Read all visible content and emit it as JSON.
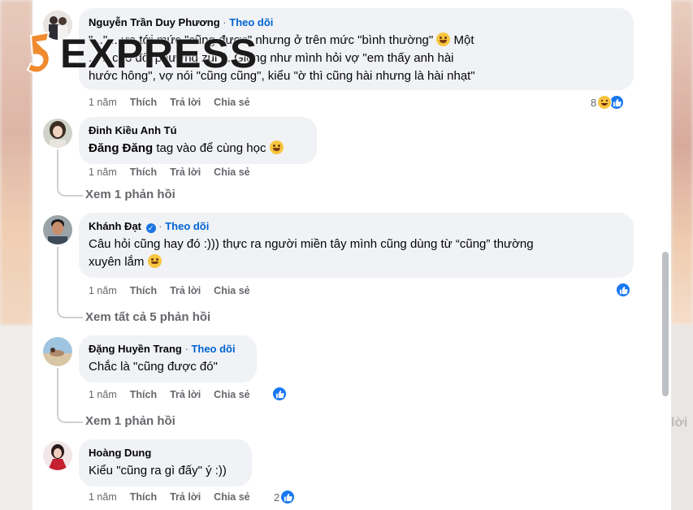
{
  "background": {
    "right_label": "lời"
  },
  "watermark": {
    "text": "EXPRESS"
  },
  "comments": [
    {
      "author": "Nguyễn Trần Duy Phương",
      "follow": "Theo dõi",
      "text_line1": "\"...\" ...ưa tới mức \"cũng được\" nhưng ở trên mức \"bình thường\"",
      "text_line1_tail": "Một",
      "text_line2": "... ...cho đối phương zui á. Giống như mình hỏi vợ \"em thấy anh hài",
      "text_line3": "hước hông\", vợ nói \"cũng cũng\", kiểu \"ờ thì cũng hài nhưng là hài nhạt\"",
      "time": "1 năm",
      "like": "Thích",
      "reply": "Trả lời",
      "share": "Chia sẻ",
      "reaction_count": "8"
    },
    {
      "author": "Đinh Kiều Anh Tú",
      "mention": "Đăng Đăng",
      "text": "tag vào để cùng học",
      "time": "1 năm",
      "like": "Thích",
      "reply": "Trả lời",
      "share": "Chia sẻ",
      "view_replies": "Xem 1 phản hồi"
    },
    {
      "author": "Khánh Đạt",
      "follow": "Theo dõi",
      "text_line1": "Câu hỏi cũng hay đó :))) thực ra người miền tây mình cũng dùng từ “cũng” thường",
      "text_line2": "xuyên lắm",
      "time": "1 năm",
      "like": "Thích",
      "reply": "Trả lời",
      "share": "Chia sẻ",
      "view_replies": "Xem tất cả 5 phản hồi"
    },
    {
      "author": "Đặng Huyền Trang",
      "follow": "Theo dõi",
      "text": "Chắc là \"cũng được đó\"",
      "time": "1 năm",
      "like": "Thích",
      "reply": "Trả lời",
      "share": "Chia sẻ",
      "view_replies": "Xem 1 phản hồi"
    },
    {
      "author": "Hoàng Dung",
      "text": "Kiểu \"cũng ra gì đấy\" ý :))",
      "time": "1 năm",
      "like": "Thích",
      "reply": "Trả lời",
      "share": "Chia sẻ",
      "reaction_count": "2"
    }
  ],
  "colors": {
    "link_blue": "#0064d1",
    "like_blue": "#1877f2",
    "bubble": "#f0f2f5",
    "meta_gray": "#65676b"
  },
  "icons": [
    "like-icon",
    "haha-icon",
    "verified-badge-icon",
    "laugh-emoji-icon",
    "smile-emoji-icon"
  ]
}
